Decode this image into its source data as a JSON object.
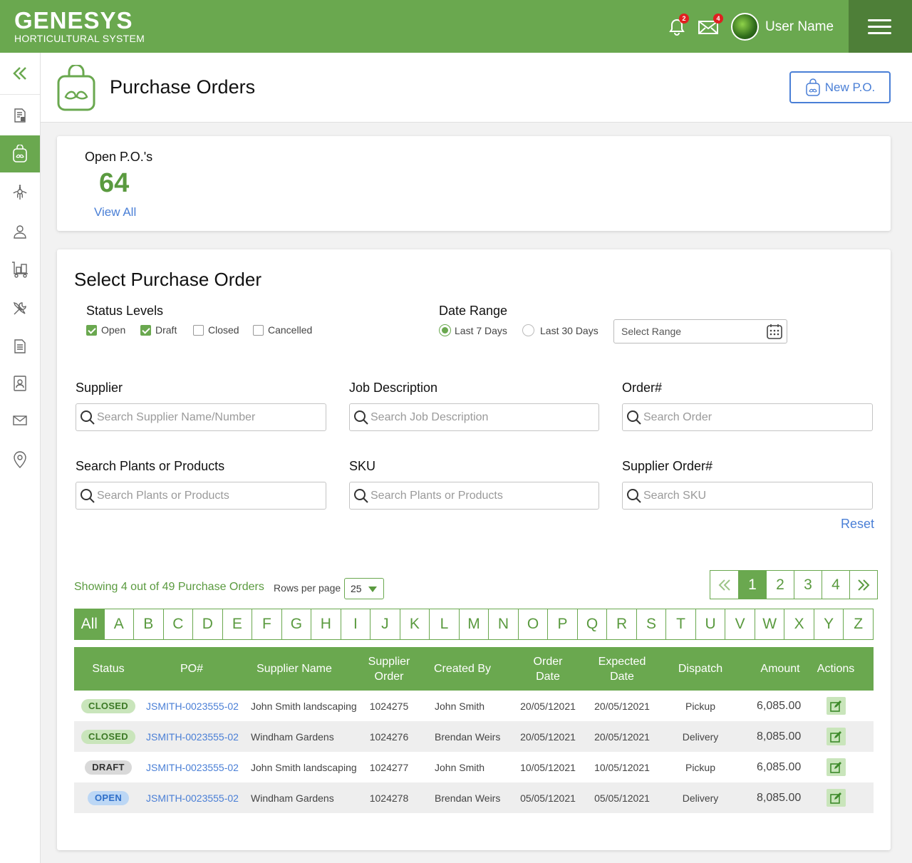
{
  "brand": {
    "name": "GENESYS",
    "subtitle": "HORTICULTURAL SYSTEM",
    "color": "#6aa84f"
  },
  "topbar": {
    "notifications": {
      "icon": "bell-icon",
      "count": "2"
    },
    "messages": {
      "icon": "envelope-icon",
      "count": "4"
    },
    "user_name": "User Name",
    "menu_icon": "hamburger-icon"
  },
  "sidebar": {
    "collapse_icon": "double-chevron-left-icon",
    "items": [
      {
        "icon": "document-list-icon",
        "active": false
      },
      {
        "icon": "shopping-bag-leaf-icon",
        "active": true
      },
      {
        "icon": "flower-icon",
        "active": false
      },
      {
        "icon": "user-icon",
        "active": false
      },
      {
        "icon": "trolley-icon",
        "active": false
      },
      {
        "icon": "tools-icon",
        "active": false
      },
      {
        "icon": "document-icon",
        "active": false
      },
      {
        "icon": "contact-book-icon",
        "active": false
      },
      {
        "icon": "mail-icon",
        "active": false
      },
      {
        "icon": "map-pin-icon",
        "active": false
      }
    ]
  },
  "header": {
    "title": "Purchase Orders",
    "new_button": "New P.O."
  },
  "summary": {
    "label": "Open P.O.'s",
    "count": "64",
    "view_all": "View All"
  },
  "filters": {
    "title": "Select Purchase Order",
    "status_label": "Status Levels",
    "statuses": [
      {
        "label": "Open",
        "checked": true
      },
      {
        "label": "Draft",
        "checked": true
      },
      {
        "label": "Closed",
        "checked": false
      },
      {
        "label": "Cancelled",
        "checked": false
      }
    ],
    "date_label": "Date Range",
    "date_options": [
      {
        "label": "Last 7 Days",
        "selected": true
      },
      {
        "label": "Last 30 Days",
        "selected": false
      }
    ],
    "range_placeholder": "Select Range",
    "fields": [
      {
        "label": "Supplier",
        "placeholder": "Search Supplier Name/Number"
      },
      {
        "label": "Job Description",
        "placeholder": "Search Job Description"
      },
      {
        "label": "Order#",
        "placeholder": "Search Order"
      },
      {
        "label": "Search Plants or Products",
        "placeholder": "Search Plants or Products"
      },
      {
        "label": "SKU",
        "placeholder": "Search Plants or Products"
      },
      {
        "label": "Supplier Order#",
        "placeholder": "Search SKU"
      }
    ],
    "reset": "Reset"
  },
  "listing": {
    "showing": "Showing 4 out of 49  Purchase Orders",
    "rows_per_page_label": "Rows per page",
    "rows_per_page": "25",
    "pages": [
      "1",
      "2",
      "3",
      "4"
    ],
    "current_page": "1",
    "first_icon": "double-chevron-left-icon",
    "last_icon": "double-chevron-right-icon",
    "letters": [
      "All",
      "A",
      "B",
      "C",
      "D",
      "E",
      "F",
      "G",
      "H",
      "I",
      "J",
      "K",
      "L",
      "M",
      "N",
      "O",
      "P",
      "Q",
      "R",
      "S",
      "T",
      "U",
      "V",
      "W",
      "X",
      "Y",
      "Z"
    ]
  },
  "table": {
    "columns": [
      "Status",
      "PO#",
      "Supplier Name",
      "Supplier Order",
      "Created By",
      "Order Date",
      "Expected Date",
      "Dispatch",
      "Amount",
      "Actions"
    ],
    "rows": [
      {
        "status": "CLOSED",
        "po": "JSMITH-0023555-02",
        "supplier": "John Smith landscaping",
        "supplier_order": "1024275",
        "created_by": "John Smith",
        "order_date": "20/05/12021",
        "expected_date": "20/05/12021",
        "dispatch": "Pickup",
        "amount": "6,085.00"
      },
      {
        "status": "CLOSED",
        "po": "JSMITH-0023555-02",
        "supplier": "Windham Gardens",
        "supplier_order": "1024276",
        "created_by": "Brendan Weirs",
        "order_date": "20/05/12021",
        "expected_date": "20/05/12021",
        "dispatch": "Delivery",
        "amount": "8,085.00"
      },
      {
        "status": "DRAFT",
        "po": "JSMITH-0023555-02",
        "supplier": "John Smith landscaping",
        "supplier_order": "1024277",
        "created_by": "John Smith",
        "order_date": "10/05/12021",
        "expected_date": "10/05/12021",
        "dispatch": "Pickup",
        "amount": "6,085.00"
      },
      {
        "status": "OPEN",
        "po": "JSMITH-0023555-02",
        "supplier": "Windham Gardens",
        "supplier_order": "1024278",
        "created_by": "Brendan Weirs",
        "order_date": "05/05/12021",
        "expected_date": "05/05/12021",
        "dispatch": "Delivery",
        "amount": "8,085.00"
      }
    ],
    "status_colors": {
      "CLOSED": {
        "bg": "#c9e5bb",
        "fg": "#3d7a26"
      },
      "DRAFT": {
        "bg": "#d9d9d9",
        "fg": "#333333"
      },
      "OPEN": {
        "bg": "#bcd7f5",
        "fg": "#2f6fc9"
      }
    },
    "action_icon": "edit-icon"
  }
}
